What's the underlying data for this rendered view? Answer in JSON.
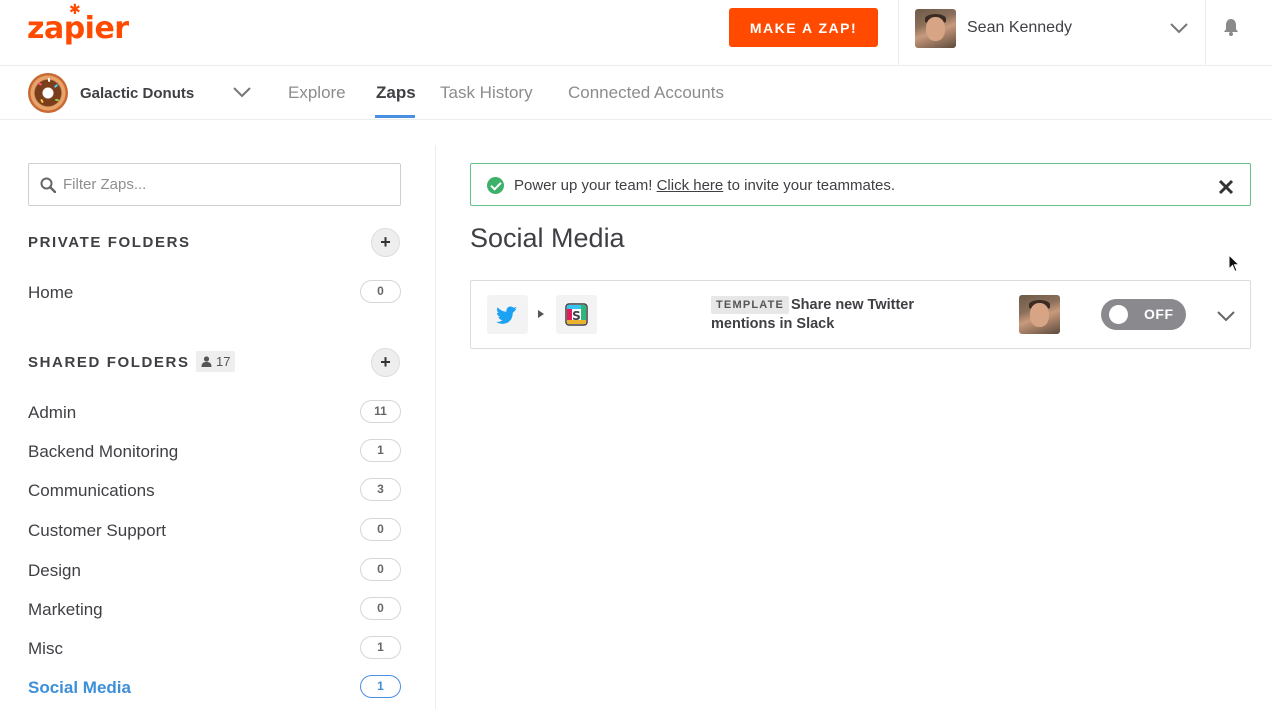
{
  "header": {
    "logo_text": "zapier",
    "make_zap_label": "MAKE A ZAP!",
    "user_name": "Sean Kennedy"
  },
  "subnav": {
    "team_name": "Galactic Donuts",
    "tabs": [
      {
        "label": "Explore"
      },
      {
        "label": "Zaps"
      },
      {
        "label": "Task History"
      },
      {
        "label": "Connected Accounts"
      }
    ],
    "active_tab": "Zaps"
  },
  "sidebar": {
    "filter_placeholder": "Filter Zaps...",
    "private_title": "PRIVATE FOLDERS",
    "private_folders": [
      {
        "name": "Home",
        "count": "0"
      }
    ],
    "shared_title": "SHARED FOLDERS",
    "shared_members": "17",
    "shared_folders": [
      {
        "name": "Admin",
        "count": "11"
      },
      {
        "name": "Backend Monitoring",
        "count": "1"
      },
      {
        "name": "Communications",
        "count": "3"
      },
      {
        "name": "Customer Support",
        "count": "0"
      },
      {
        "name": "Design",
        "count": "0"
      },
      {
        "name": "Marketing",
        "count": "0"
      },
      {
        "name": "Misc",
        "count": "1"
      },
      {
        "name": "Social Media",
        "count": "1"
      }
    ],
    "active_folder": "Social Media"
  },
  "banner": {
    "text_before": "Power up your team! ",
    "link_text": "Click here",
    "text_after": " to invite your teammates."
  },
  "main": {
    "folder_title": "Social Media",
    "zaps": [
      {
        "tag": "TEMPLATE",
        "title": "Share new Twitter mentions in Slack",
        "trigger_app_icon": "twitter-icon",
        "action_app_icon": "slack-icon",
        "status_label": "OFF"
      }
    ]
  },
  "colors": {
    "brand": "#ff4a00",
    "accent": "#4a90e2",
    "success": "#3db06a",
    "toggle_off": "#8a8a8e"
  }
}
